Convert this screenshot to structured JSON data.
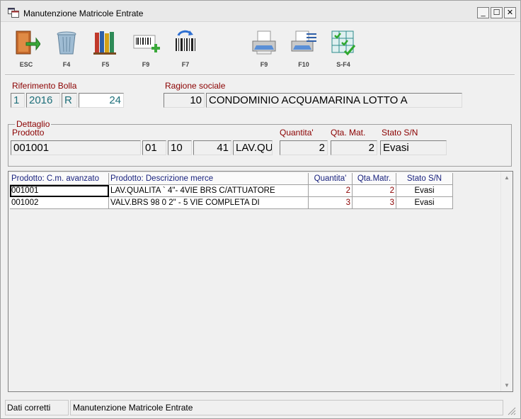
{
  "window": {
    "title": "Manutenzione Matricole Entrate"
  },
  "toolbar": [
    {
      "key": "ESC",
      "icon": "exit-door-icon"
    },
    {
      "key": "F4",
      "icon": "trash-icon"
    },
    {
      "key": "F5",
      "icon": "books-icon"
    },
    {
      "key": "F9",
      "icon": "barcode-add-icon"
    },
    {
      "key": "F7",
      "icon": "barcode-refresh-icon"
    },
    {
      "key": "F9",
      "icon": "printer-icon"
    },
    {
      "key": "F10",
      "icon": "printer-list-icon"
    },
    {
      "key": "S-F4",
      "icon": "grid-check-icon"
    }
  ],
  "riferimento": {
    "label": "Riferimento Bolla",
    "num": "1",
    "anno": "2016",
    "serie": "R",
    "numero": "24"
  },
  "ragione": {
    "label": "Ragione sociale",
    "code": "10",
    "name": "CONDOMINIO ACQUAMARINA   LOTTO A"
  },
  "dettaglio": {
    "title": "Dettaglio",
    "prodotto_label": "Prodotto",
    "prodotto": "001001",
    "code1": "01",
    "code2": "10",
    "code3": "41",
    "desc": "LAV.QUALITA",
    "quantita_label": "Quantita'",
    "quantita": "2",
    "qta_mat_label": "Qta. Mat.",
    "qta_mat": "2",
    "stato_label": "Stato S/N",
    "stato": "Evasi"
  },
  "grid": {
    "columns": [
      "Prodotto: C.m. avanzato",
      "Prodotto: Descrizione merce",
      "Quantita'",
      "Qta.Matr.",
      "Stato S/N"
    ],
    "rows": [
      {
        "code": "001001",
        "desc": "LAV.QUALITA ` 4\"- 4VIE BRS C/ATTUATORE",
        "qty": "2",
        "qty_matr": "2",
        "stato": "Evasi"
      },
      {
        "code": "001002",
        "desc": "VALV.BRS 98 0 2\" - 5 VIE COMPLETA DI",
        "qty": "3",
        "qty_matr": "3",
        "stato": "Evasi"
      }
    ]
  },
  "status": {
    "left": "Dati corretti",
    "right": "Manutenzione Matricole Entrate"
  }
}
